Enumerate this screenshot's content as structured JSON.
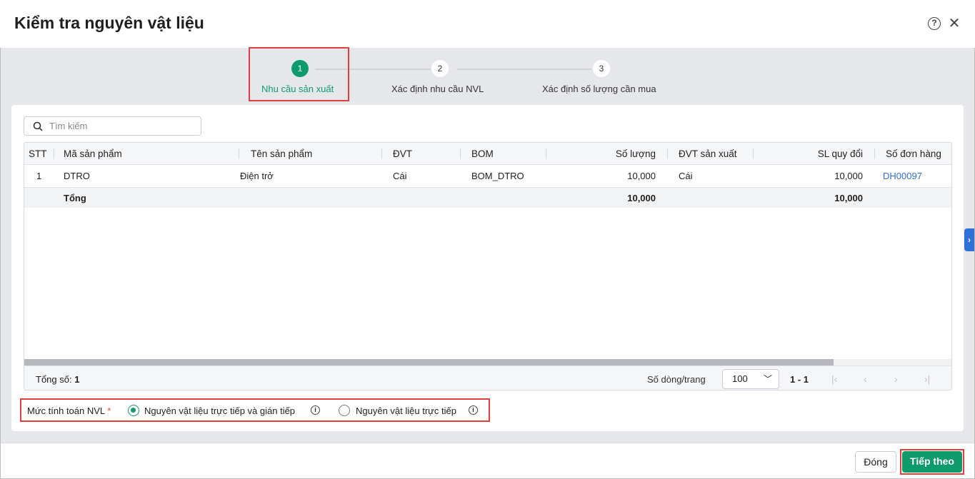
{
  "dialog": {
    "title": "Kiểm tra nguyên vật liệu",
    "help_icon": "question-circle-icon",
    "close_icon": "close-icon"
  },
  "stepper": {
    "steps": [
      {
        "num": "1",
        "label": "Nhu cầu sản xuất",
        "active": true
      },
      {
        "num": "2",
        "label": "Xác định nhu cầu NVL"
      },
      {
        "num": "3",
        "label": "Xác định số lượng cần mua"
      }
    ]
  },
  "search": {
    "placeholder": "Tìm kiếm"
  },
  "table": {
    "columns": [
      "STT",
      "Mã sản phẩm",
      "Tên sản phẩm",
      "ĐVT",
      "BOM",
      "Số lượng",
      "ĐVT sản xuất",
      "SL quy đổi",
      "Số đơn hàng"
    ],
    "rows": [
      {
        "stt": "1",
        "code": "DTRO",
        "name": "Điện trở",
        "unit": "Cái",
        "bom": "BOM_DTRO",
        "qty": "10,000",
        "prod_unit": "Cái",
        "conv_qty": "10,000",
        "order": "DH00097"
      }
    ],
    "total": {
      "label": "Tổng",
      "qty": "10,000",
      "conv_qty": "10,000"
    }
  },
  "pagination": {
    "total_label": "Tổng số:",
    "total": "1",
    "rows_per_page_label": "Số dòng/trang",
    "rows_per_page": "100",
    "range": "1 - 1"
  },
  "calc_level": {
    "label": "Mức tính toán NVL",
    "required": "*",
    "options": [
      {
        "label": "Nguyên vật liệu trực tiếp và gián tiếp",
        "selected": true
      },
      {
        "label": "Nguyên vật liệu trực tiếp",
        "selected": false
      }
    ]
  },
  "footer": {
    "close": "Đóng",
    "next": "Tiếp theo"
  },
  "colors": {
    "accent": "#0e9b6c",
    "link": "#2e6fd8",
    "highlight": "#e0403c"
  }
}
